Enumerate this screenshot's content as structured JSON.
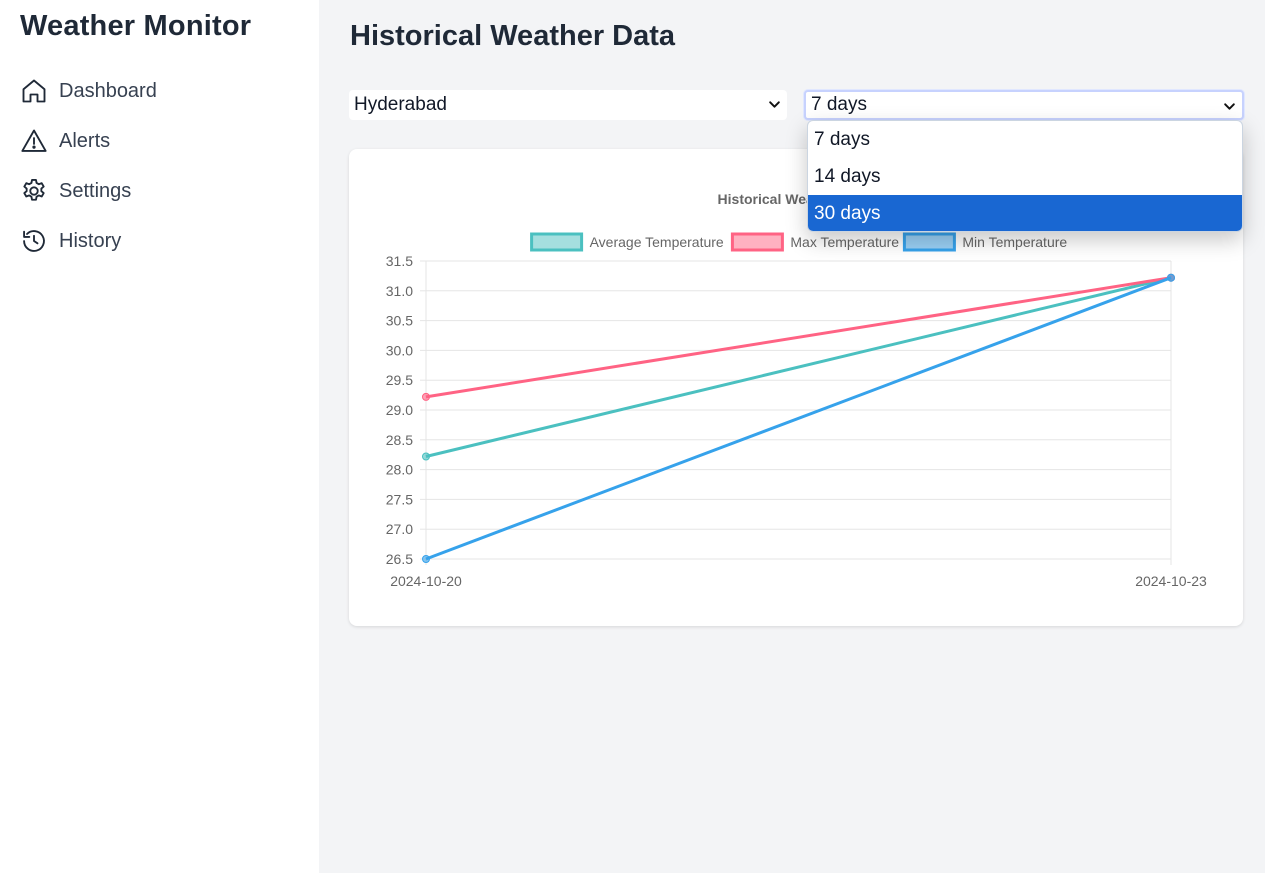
{
  "app": {
    "title": "Weather Monitor"
  },
  "sidebar": {
    "items": [
      {
        "label": "Dashboard",
        "icon": "home-icon"
      },
      {
        "label": "Alerts",
        "icon": "alert-triangle-icon"
      },
      {
        "label": "Settings",
        "icon": "gear-icon"
      },
      {
        "label": "History",
        "icon": "history-icon"
      }
    ]
  },
  "page": {
    "title": "Historical Weather Data"
  },
  "filters": {
    "city": {
      "value": "Hyderabad"
    },
    "range": {
      "value": "7 days",
      "options": [
        "7 days",
        "14 days",
        "30 days"
      ],
      "highlighted": "30 days"
    }
  },
  "colors": {
    "highlight": "#1967d2",
    "avg": "#4bc0c0",
    "max": "#ff6384",
    "min": "#36a2eb"
  },
  "chart_data": {
    "type": "line",
    "title": "Historical Weather Data",
    "categories": [
      "2024-10-20",
      "2024-10-23"
    ],
    "series": [
      {
        "name": "Average Temperature",
        "values": [
          28.22,
          31.22
        ],
        "color": "#4bc0c0"
      },
      {
        "name": "Max Temperature",
        "values": [
          29.22,
          31.22
        ],
        "color": "#ff6384"
      },
      {
        "name": "Min Temperature",
        "values": [
          26.5,
          31.22
        ],
        "color": "#36a2eb"
      }
    ],
    "ylim": [
      26.5,
      31.5
    ],
    "yticks": [
      "31.5",
      "31.0",
      "30.5",
      "30.0",
      "29.5",
      "29.0",
      "28.5",
      "28.0",
      "27.5",
      "27.0",
      "26.5"
    ],
    "grid": true,
    "legend": "top"
  }
}
